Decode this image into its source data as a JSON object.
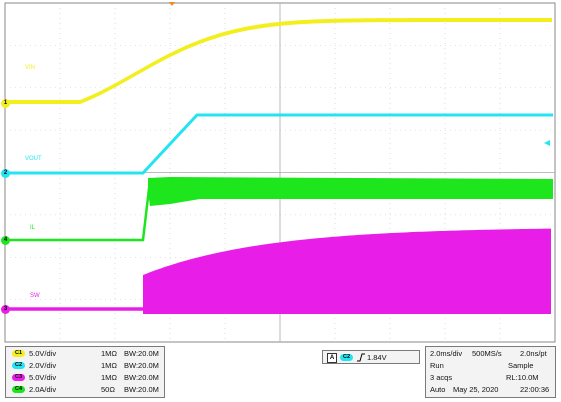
{
  "colors": {
    "ch1": "#f2ef1d",
    "ch2": "#23e4f2",
    "ch3": "#e81ee8",
    "ch4": "#1de61d",
    "grid": "#c8c8c8",
    "frame": "#8a8a8a"
  },
  "waveforms": {
    "labels": {
      "vin": "VIN",
      "vout": "VOUT",
      "il": "IL",
      "sw": "SW"
    },
    "markers": {
      "ch1": "1",
      "ch2": "2",
      "ch4": "4",
      "ch3": "3"
    }
  },
  "channels": [
    {
      "badge": "C1",
      "scale": "5.0V/div",
      "impedance": "1MΩ",
      "bw": "BW:20.0M"
    },
    {
      "badge": "C2",
      "scale": "2.0V/div",
      "impedance": "1MΩ",
      "bw": "BW:20.0M"
    },
    {
      "badge": "C3",
      "scale": "5.0V/div",
      "impedance": "1MΩ",
      "bw": "BW:20.0M"
    },
    {
      "badge": "C4",
      "scale": "2.0A/div",
      "impedance": "50Ω",
      "bw": "BW:20.0M"
    }
  ],
  "trigger": {
    "mode_letter": "A",
    "source": "C2",
    "level": "1.84V",
    "slope_icon": "rising-edge-icon"
  },
  "acquisition": {
    "timebase": "2.0ms/div",
    "sample_rate": "500MS/s",
    "resolution": "2.0ns/pt",
    "run_state": "Run",
    "acq_mode": "Sample",
    "acq_count": "3 acqs",
    "record_length": "RL:10.0M",
    "trigger_mode": "Auto",
    "date": "May 25, 2020",
    "time": "22:00:36"
  }
}
